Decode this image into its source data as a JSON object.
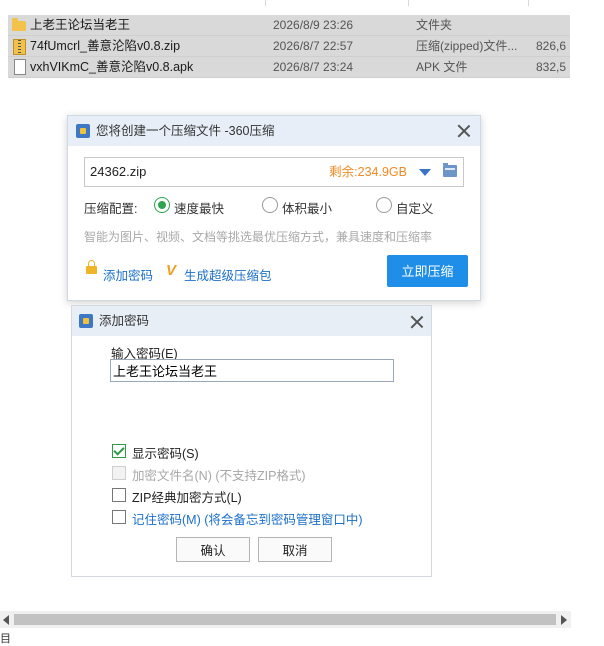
{
  "explorer": {
    "files": [
      {
        "name": "上老王论坛当老王",
        "date": "2026/8/9 23:26",
        "type": "文件夹",
        "size": "",
        "icon": "folder-icon"
      },
      {
        "name": "74fUmcrl_善意沦陷v0.8.zip",
        "date": "2026/8/7 22:57",
        "type": "压缩(zipped)文件...",
        "size": "826,6",
        "icon": "zip-icon"
      },
      {
        "name": "vxhVIKmC_善意沦陷v0.8.apk",
        "date": "2026/8/7 23:24",
        "type": "APK 文件",
        "size": "832,5",
        "icon": "file-icon"
      }
    ],
    "status_fragment": "目"
  },
  "compress_dialog": {
    "title": "您将创建一个压缩文件 -360压缩",
    "filename": "24362.zip",
    "free_space": "剩余:234.9GB",
    "option_label": "压缩配置:",
    "options": [
      "速度最快",
      "体积最小",
      "自定义"
    ],
    "selected_option": "速度最快",
    "hint": "智能为图片、视频、文档等挑选最优压缩方式，兼具速度和压缩率",
    "add_password_link": "添加密码",
    "super_zip_link": "生成超级压缩包",
    "start_button": "立即压缩",
    "accent_color": "#1e8ee8"
  },
  "password_dialog": {
    "title": "添加密码",
    "field_label": "输入密码(E)",
    "password_value": "上老王论坛当老王",
    "checkboxes": [
      {
        "label": "显示密码(S)",
        "checked": true,
        "disabled": false
      },
      {
        "label": "加密文件名(N)  (不支持ZIP格式)",
        "checked": false,
        "disabled": true
      },
      {
        "label": "ZIP经典加密方式(L)",
        "checked": false,
        "disabled": false
      },
      {
        "label": "记住密码(M)  (将会备忘到密码管理窗口中)",
        "checked": false,
        "disabled": false
      }
    ],
    "ok_button": "确认",
    "cancel_button": "取消"
  }
}
